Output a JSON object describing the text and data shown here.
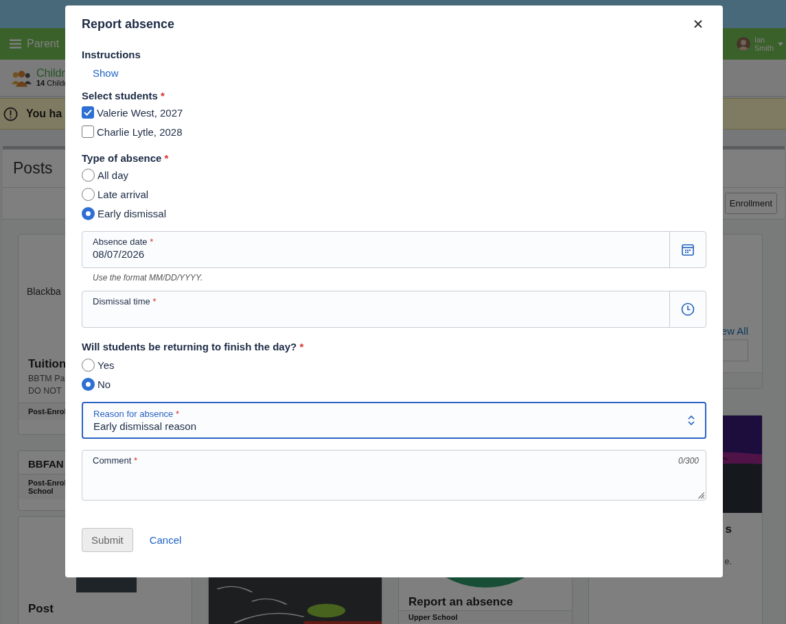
{
  "top_nav": {
    "menu_label": "Parent",
    "user_lines": [
      "Ian",
      "Smith"
    ]
  },
  "header": {
    "title": "Childr",
    "count": "14",
    "count_label": "Childr"
  },
  "alert": {
    "text": "You ha"
  },
  "posts": {
    "title": "Posts",
    "enroll_button": "Enrollment",
    "columns": [
      [
        {
          "kind": "logo",
          "logo": "Blackba",
          "title": "Tuition",
          "lines": [
            "BBTM Pa",
            "DO NOT"
          ],
          "footer": [
            "Post-Enrol"
          ]
        },
        {
          "kind": "text",
          "title": "BBFAN",
          "footer": [
            "Post-Enrol",
            "School"
          ]
        },
        {
          "kind": "picture",
          "title": "Post"
        }
      ],
      [
        {
          "kind": "picture"
        }
      ],
      [
        {
          "kind": "picture",
          "title": "Report an absence",
          "footer": [
            "Upper School"
          ]
        }
      ],
      [
        {
          "kind": "widget",
          "link": "ew All"
        },
        {
          "kind": "picture",
          "title": "s",
          "lines": [
            "e."
          ]
        }
      ]
    ]
  },
  "dialog": {
    "title": "Report absence",
    "instructions": {
      "label": "Instructions",
      "link": "Show"
    },
    "students": {
      "label": "Select students",
      "required_mark": "*",
      "options": [
        {
          "label": "Valerie West, 2027",
          "checked": true
        },
        {
          "label": "Charlie Lytle, 2028",
          "checked": false
        }
      ]
    },
    "absence_type": {
      "label": "Type of absence",
      "required_mark": "*",
      "options": [
        {
          "label": "All day",
          "selected": false
        },
        {
          "label": "Late arrival",
          "selected": false
        },
        {
          "label": "Early dismissal",
          "selected": true
        }
      ]
    },
    "date_field": {
      "label": "Absence date",
      "required_mark": "*",
      "value": "08/07/2026",
      "help": "Use the format MM/DD/YYYY."
    },
    "time_field": {
      "label": "Dismissal time",
      "required_mark": "*"
    },
    "returning": {
      "label": "Will students be returning to finish the day?",
      "required_mark": "*",
      "options": [
        {
          "label": "Yes",
          "selected": false
        },
        {
          "label": "No",
          "selected": true
        }
      ]
    },
    "reason_field": {
      "label": "Reason for absence",
      "required_mark": "*",
      "value": "Early dismissal reason",
      "focused": true
    },
    "comment_field": {
      "label": "Comment",
      "required_mark": "*",
      "counter": "0/300"
    },
    "buttons": {
      "submit": "Submit",
      "submit_disabled": true,
      "cancel": "Cancel"
    }
  }
}
